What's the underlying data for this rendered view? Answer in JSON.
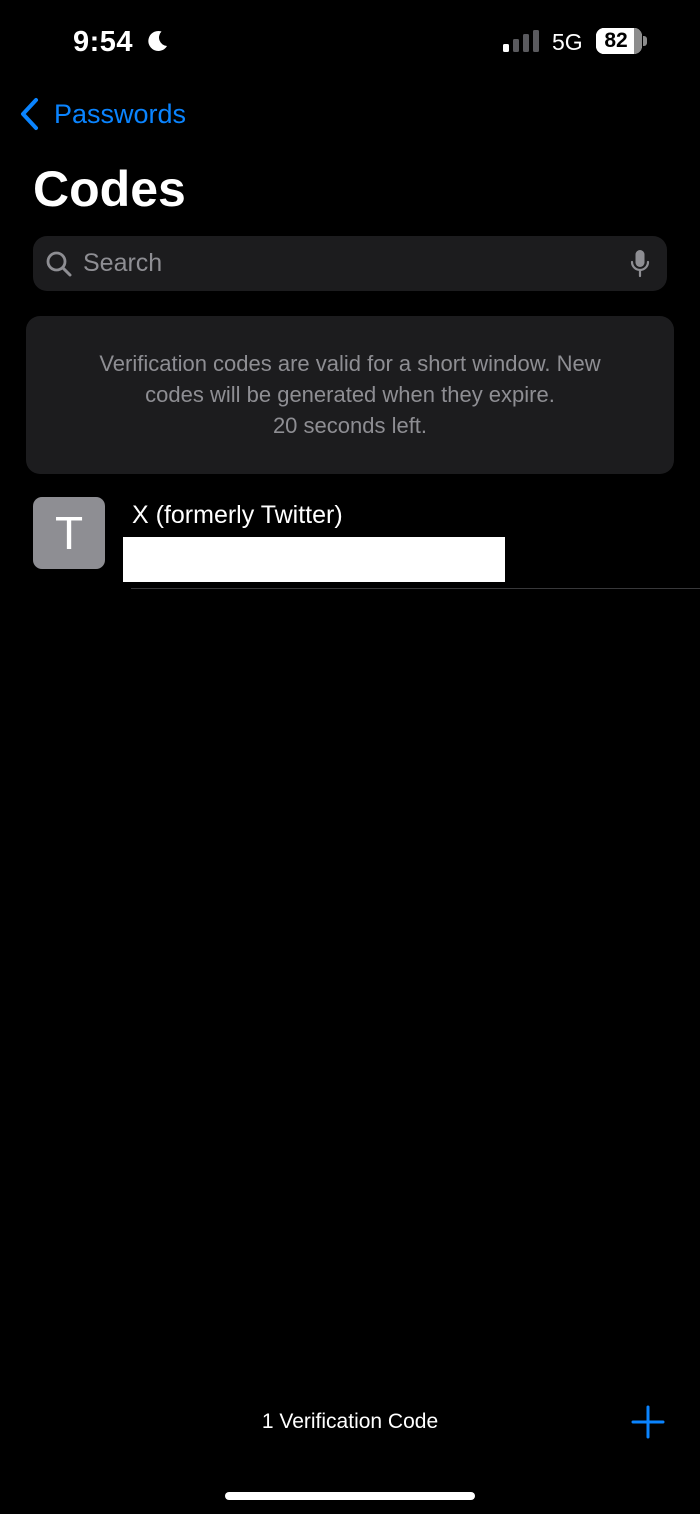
{
  "status_bar": {
    "time": "9:54",
    "network": "5G",
    "battery_percent": "82",
    "focus_icon": "moon-icon",
    "signal_icon": "cellular-signal-icon"
  },
  "nav": {
    "back_label": "Passwords",
    "back_icon": "chevron-left-icon",
    "title": "Codes"
  },
  "search": {
    "placeholder": "Search",
    "value": "",
    "icon": "search-icon",
    "mic_icon": "microphone-icon"
  },
  "info": {
    "line1": "Verification codes are valid for a short window. New",
    "line2": "codes will be generated when they expire.",
    "line3": "20 seconds left."
  },
  "codes": [
    {
      "avatar_letter": "T",
      "title": "X (formerly Twitter)",
      "code": ""
    }
  ],
  "footer": {
    "count_label": "1 Verification Code",
    "add_icon": "plus-icon"
  },
  "colors": {
    "background": "#000000",
    "accent": "#0a84ff",
    "card": "#1c1c1e",
    "secondary_text": "#8e8e93",
    "avatar": "#8e8e93"
  }
}
